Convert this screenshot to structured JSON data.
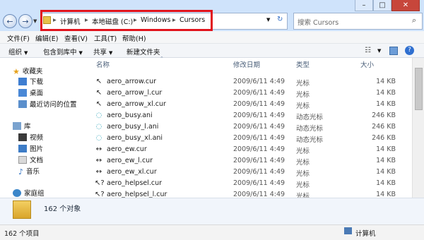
{
  "address": {
    "crumbs": [
      "计算机",
      "本地磁盘 (C:)",
      "Windows",
      "Cursors"
    ]
  },
  "search": {
    "placeholder": "搜索 Cursors"
  },
  "menu": [
    "文件(F)",
    "编辑(E)",
    "查看(V)",
    "工具(T)",
    "帮助(H)"
  ],
  "toolbar": {
    "organize": "组织",
    "include": "包含到库中",
    "share": "共享",
    "new_folder": "新建文件夹"
  },
  "sidebar": {
    "favorites": "收藏夹",
    "favorites_items": [
      "下载",
      "桌面",
      "最近访问的位置"
    ],
    "libraries": "库",
    "library_items": [
      "视频",
      "图片",
      "文档",
      "音乐"
    ],
    "homegroup": "家庭组"
  },
  "columns": {
    "name": "名称",
    "date": "修改日期",
    "type": "类型",
    "size": "大小"
  },
  "files": [
    {
      "name": "aero_arrow.cur",
      "date": "2009/6/11 4:49",
      "type": "光标",
      "size": "14 KB",
      "icon": "arrow-cursor-icon"
    },
    {
      "name": "aero_arrow_l.cur",
      "date": "2009/6/11 4:49",
      "type": "光标",
      "size": "14 KB",
      "icon": "arrow-cursor-icon"
    },
    {
      "name": "aero_arrow_xl.cur",
      "date": "2009/6/11 4:49",
      "type": "光标",
      "size": "14 KB",
      "icon": "arrow-cursor-icon"
    },
    {
      "name": "aero_busy.ani",
      "date": "2009/6/11 4:49",
      "type": "动态光标",
      "size": "246 KB",
      "icon": "busy-ring-icon"
    },
    {
      "name": "aero_busy_l.ani",
      "date": "2009/6/11 4:49",
      "type": "动态光标",
      "size": "246 KB",
      "icon": "busy-ring-icon"
    },
    {
      "name": "aero_busy_xl.ani",
      "date": "2009/6/11 4:49",
      "type": "动态光标",
      "size": "246 KB",
      "icon": "busy-ring-icon"
    },
    {
      "name": "aero_ew.cur",
      "date": "2009/6/11 4:49",
      "type": "光标",
      "size": "14 KB",
      "icon": "resize-ew-icon"
    },
    {
      "name": "aero_ew_l.cur",
      "date": "2009/6/11 4:49",
      "type": "光标",
      "size": "14 KB",
      "icon": "resize-ew-icon"
    },
    {
      "name": "aero_ew_xl.cur",
      "date": "2009/6/11 4:49",
      "type": "光标",
      "size": "14 KB",
      "icon": "resize-ew-icon"
    },
    {
      "name": "aero_helpsel.cur",
      "date": "2009/6/11 4:49",
      "type": "光标",
      "size": "14 KB",
      "icon": "help-cursor-icon"
    },
    {
      "name": "aero_helpsel_l.cur",
      "date": "2009/6/11 4:49",
      "type": "光标",
      "size": "14 KB",
      "icon": "help-cursor-icon"
    }
  ],
  "details": {
    "count": "162 个对象"
  },
  "status": {
    "left": "162 个项目",
    "right": "计算机"
  }
}
